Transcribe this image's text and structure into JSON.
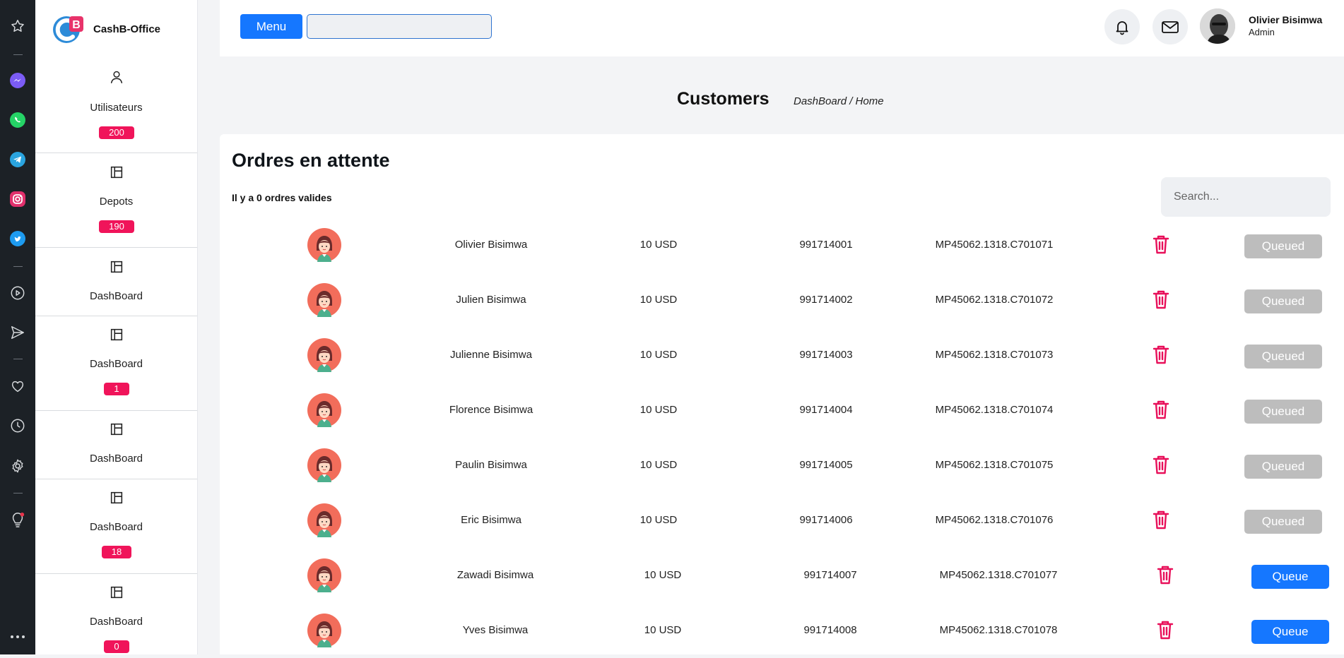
{
  "app": {
    "name": "CashB-Office"
  },
  "rail": {
    "icons": [
      "star-icon",
      "messenger-icon",
      "whatsapp-icon",
      "telegram-icon",
      "instagram-icon",
      "twitter-icon",
      "play-icon",
      "send-icon",
      "heart-icon",
      "clock-icon",
      "settings-icon",
      "lightbulb-icon",
      "more-icon"
    ]
  },
  "sidebar": {
    "items": [
      {
        "label": "Utilisateurs",
        "icon": "user-icon",
        "badge": "200"
      },
      {
        "label": "Depots",
        "icon": "layout-icon",
        "badge": "190"
      },
      {
        "label": "DashBoard",
        "icon": "layout-icon",
        "badge": ""
      },
      {
        "label": "DashBoard",
        "icon": "layout-icon",
        "badge": "1"
      },
      {
        "label": "DashBoard",
        "icon": "layout-icon",
        "badge": ""
      },
      {
        "label": "DashBoard",
        "icon": "layout-icon",
        "badge": "18"
      },
      {
        "label": "DashBoard",
        "icon": "layout-icon",
        "badge": "0"
      }
    ]
  },
  "topbar": {
    "menu_label": "Menu",
    "search_value": "",
    "user": {
      "name": "Olivier Bisimwa",
      "role": "Admin"
    }
  },
  "header": {
    "title": "Customers",
    "breadcrumb": "DashBoard / Home"
  },
  "orders": {
    "title": "Ordres en attente",
    "subtitle": "Il y a 0 ordres valides",
    "search_placeholder": "Search...",
    "rows": [
      {
        "name": "Olivier Bisimwa",
        "amount": "10 USD",
        "phone": "991714001",
        "ref": "MP45062.1318.C701071",
        "status": "Queued"
      },
      {
        "name": "Julien Bisimwa",
        "amount": "10 USD",
        "phone": "991714002",
        "ref": "MP45062.1318.C701072",
        "status": "Queued"
      },
      {
        "name": "Julienne Bisimwa",
        "amount": "10 USD",
        "phone": "991714003",
        "ref": "MP45062.1318.C701073",
        "status": "Queued"
      },
      {
        "name": "Florence Bisimwa",
        "amount": "10 USD",
        "phone": "991714004",
        "ref": "MP45062.1318.C701074",
        "status": "Queued"
      },
      {
        "name": "Paulin Bisimwa",
        "amount": "10 USD",
        "phone": "991714005",
        "ref": "MP45062.1318.C701075",
        "status": "Queued"
      },
      {
        "name": "Eric Bisimwa",
        "amount": "10 USD",
        "phone": "991714006",
        "ref": "MP45062.1318.C701076",
        "status": "Queued"
      },
      {
        "name": "Zawadi Bisimwa",
        "amount": "10 USD",
        "phone": "991714007",
        "ref": "MP45062.1318.C701077",
        "status": "Queue"
      },
      {
        "name": "Yves Bisimwa",
        "amount": "10 USD",
        "phone": "991714008",
        "ref": "MP45062.1318.C701078",
        "status": "Queue"
      }
    ]
  },
  "colors": {
    "primary": "#1577ff",
    "badge": "#f0145a",
    "trash": "#e8105a",
    "queued": "#bdbdbd",
    "rail": "#1c2126"
  }
}
